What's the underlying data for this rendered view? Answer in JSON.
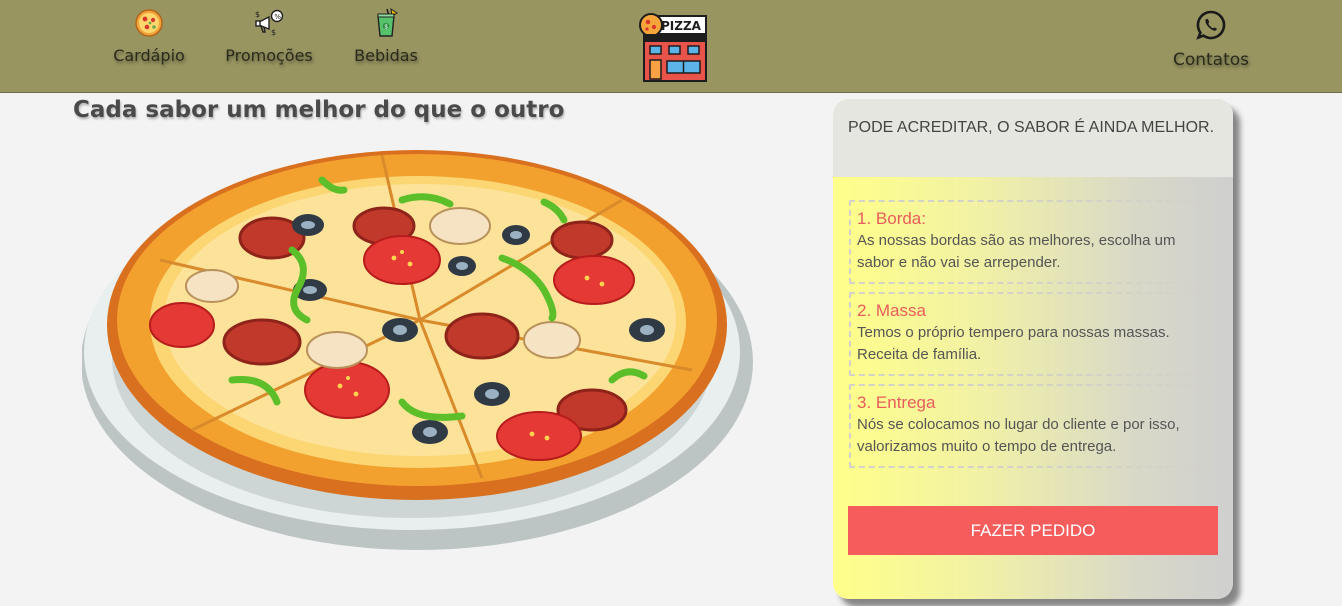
{
  "nav": {
    "items": [
      {
        "label": "Cardápio",
        "icon": "pizza-slice-icon"
      },
      {
        "label": "Promoções",
        "icon": "megaphone-icon"
      },
      {
        "label": "Bebidas",
        "icon": "drink-icon"
      }
    ],
    "logo": {
      "text": "PIZZA",
      "icon": "pizzeria-building-icon"
    },
    "contact": {
      "label": "Contatos",
      "icon": "whatsapp-icon"
    }
  },
  "main": {
    "headline": "Cada sabor um melhor do que o outro",
    "image": "pizza-illustration"
  },
  "card": {
    "header": "PODE ACREDITAR, O SABOR É AINDA MELHOR.",
    "features": [
      {
        "title": "1. Borda:",
        "text": "As nossas bordas são as melhores, escolha um sabor e não vai se arrepender."
      },
      {
        "title": "2. Massa",
        "text": "Temos o próprio tempero para nossas massas. Receita de família."
      },
      {
        "title": "3. Entrega",
        "text": "Nós se colocamos no lugar do cliente e por isso, valorizamos muito o tempo de entrega."
      }
    ],
    "button": "FAZER PEDIDO"
  },
  "colors": {
    "topbar": "#989561",
    "accent": "#f45d5b",
    "feature_title": "#e85c5c"
  }
}
